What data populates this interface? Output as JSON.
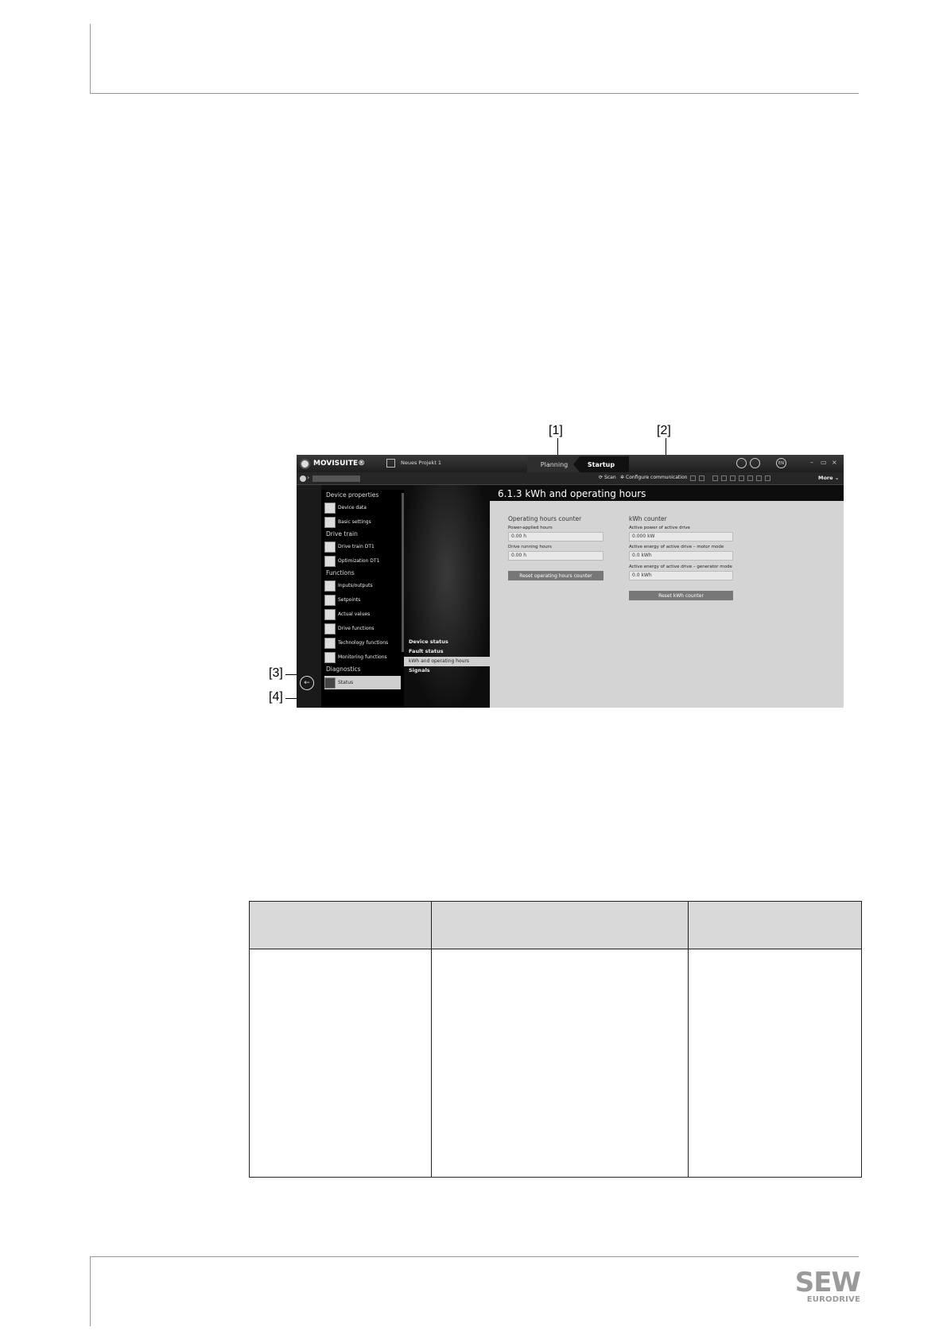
{
  "figure": {
    "callouts": {
      "c1": "[1]",
      "c2": "[2]",
      "c3": "[3]",
      "c4": "[4]"
    },
    "app": {
      "brand": "MOVISUITE®",
      "project_name": "Neues Projekt 1",
      "tabs": {
        "planning": "Planning",
        "startup": "Startup"
      },
      "language": "EN",
      "toolbar": {
        "scan": "Scan",
        "configure": "Configure communication",
        "more": "More"
      }
    },
    "nav": {
      "groups": {
        "device_properties": "Device properties",
        "drive_train": "Drive train",
        "functions": "Functions",
        "diagnostics": "Diagnostics"
      },
      "items": {
        "device_data": "Device data",
        "basic_settings": "Basic settings",
        "drive_train_dt1": "Drive train DT1",
        "optimization_dt1": "Optimization DT1",
        "inputs_outputs": "Inputs/outputs",
        "setpoints": "Setpoints",
        "actual_values": "Actual values",
        "drive_functions": "Drive functions",
        "technology_functions": "Technology functions",
        "monitoring_functions": "Monitoring functions",
        "status": "Status"
      }
    },
    "midnav": {
      "device_status": "Device status",
      "fault_status": "Fault status",
      "kwh_operating_hours": "kWh and operating hours",
      "signals": "Signals"
    },
    "content": {
      "title": "6.1.3 kWh and operating hours",
      "hours": {
        "title": "Operating hours counter",
        "power_applied_label": "Power-applied hours",
        "power_applied_value": "0.00 h",
        "drive_running_label": "Drive running hours",
        "drive_running_value": "0.00 h",
        "reset_label": "Reset operating hours counter"
      },
      "kwh": {
        "title": "kWh counter",
        "active_power_label": "Active power of active drive",
        "active_power_value": "0.000 kW",
        "energy_motor_label": "Active energy of active drive – motor mode",
        "energy_motor_value": "0.0 kWh",
        "energy_gen_label": "Active energy of active drive – generator mode",
        "energy_gen_value": "0.0 kWh",
        "reset_label": "Reset kWh counter"
      }
    }
  },
  "footer": {
    "logo_top": "SEW",
    "logo_bottom": "EURODRIVE"
  }
}
